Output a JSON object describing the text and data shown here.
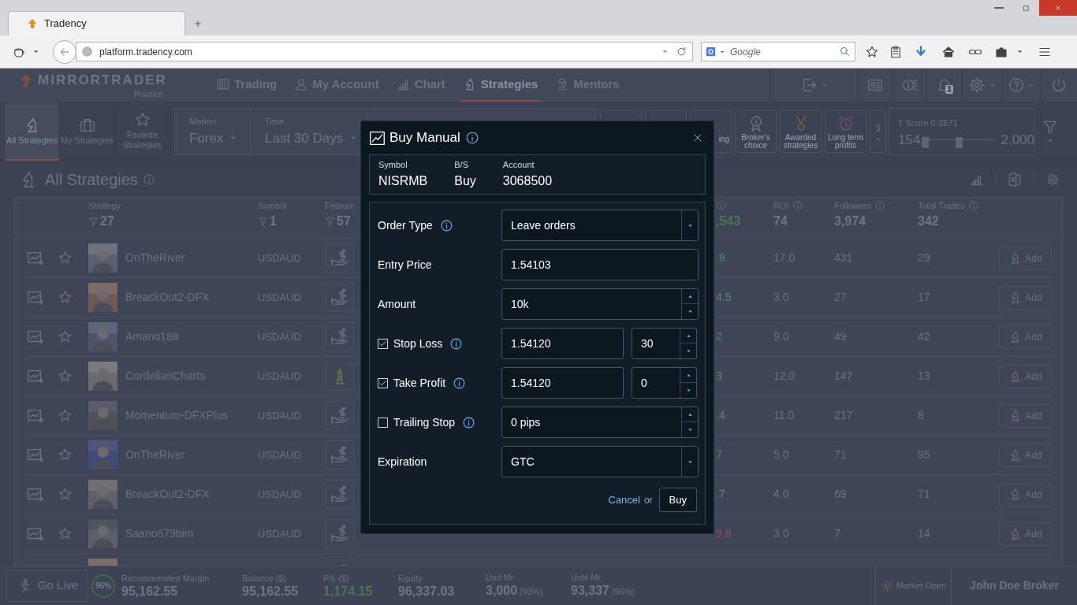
{
  "browser": {
    "tab_title": "Tradency",
    "url": "platform.tradency.com",
    "search_placeholder": "Google"
  },
  "app": {
    "logo": "MIRRORTRADER",
    "logo_sub": "Practice",
    "nav": [
      {
        "label": "Trading",
        "selected": false
      },
      {
        "label": "My Account",
        "selected": false
      },
      {
        "label": "Chart",
        "selected": false
      },
      {
        "label": "Strategies",
        "selected": true
      },
      {
        "label": "Mentors",
        "selected": false
      }
    ],
    "notification_count": "3",
    "views": [
      {
        "label": "All Strategies",
        "selected": true
      },
      {
        "label": "My Strategies",
        "selected": false
      },
      {
        "label": "Favorite Strategies",
        "selected": false
      }
    ],
    "filters": [
      {
        "label": "Market",
        "value": "Forex"
      },
      {
        "label": "Time",
        "value": "Last 30 Days"
      }
    ],
    "badges": [
      {
        "label": "ing",
        "kind": "partial"
      },
      {
        "label": "Broker's choice",
        "kind": "medal"
      },
      {
        "label": "Awarded strategies",
        "kind": "award"
      },
      {
        "label": "Long term profits",
        "kind": "clock"
      }
    ],
    "more_badges": "3",
    "tscore": {
      "label": "T Score 0-3571",
      "min": "154",
      "max": "2,000"
    },
    "page_title": "All Strategies",
    "table": {
      "columns": [
        {
          "label": "Strategy",
          "count": "27",
          "kind": "filter"
        },
        {
          "label": "Symbol",
          "count": "1",
          "kind": "filter"
        },
        {
          "label": "Feature",
          "count": "57",
          "kind": "filter"
        },
        {
          "count": ",543",
          "kind": "info",
          "positive": true
        },
        {
          "label": "ROI",
          "count": "74",
          "kind": "info"
        },
        {
          "label": "Followers",
          "count": "3,974",
          "kind": "info"
        },
        {
          "label": "Total Trades",
          "count": "342",
          "kind": "info"
        }
      ],
      "rows": [
        {
          "name": "OnTheRiver",
          "symbol": "USDAUD",
          "features": [
            {
              "kind": "hand"
            }
          ],
          "column_4": ".8",
          "negative": false,
          "roi": "17.0",
          "followers": "431",
          "trades": "29",
          "action": "Add"
        },
        {
          "name": "BreackOut2-DFX",
          "symbol": "USDAUD",
          "features": [
            {
              "kind": "hand"
            }
          ],
          "column_4": "4.5",
          "negative": false,
          "roi": "3.0",
          "followers": "27",
          "trades": "17",
          "action": "Add"
        },
        {
          "name": "Amano188",
          "symbol": "USDAUD",
          "features": [
            {
              "kind": "hand"
            }
          ],
          "column_4": "2",
          "negative": false,
          "roi": "9.0",
          "followers": "49",
          "trades": "42",
          "action": "Add"
        },
        {
          "name": "CordelianCharts",
          "symbol": "USDAUD",
          "features": [
            {
              "kind": "lighthouse"
            }
          ],
          "column_4": "3",
          "negative": false,
          "roi": "12.0",
          "followers": "147",
          "trades": "13",
          "action": "Add"
        },
        {
          "name": "Momentum-DFXPlus",
          "symbol": "USDAUD",
          "features": [
            {
              "kind": "hand"
            }
          ],
          "column_4": ".4",
          "negative": false,
          "roi": "11.0",
          "followers": "217",
          "trades": "8",
          "action": "Add"
        },
        {
          "name": "OnTheRiver",
          "symbol": "USDAUD",
          "features": [
            {
              "kind": "hand"
            }
          ],
          "column_4": "7",
          "negative": false,
          "roi": "5.0",
          "followers": "71",
          "trades": "95",
          "action": "Add"
        },
        {
          "name": "BreackOut2-DFX",
          "symbol": "USDAUD",
          "features": [
            {
              "kind": "hand"
            }
          ],
          "column_4": ".7",
          "negative": false,
          "roi": "4.0",
          "followers": "69",
          "trades": "71",
          "action": "Add"
        },
        {
          "name": "Saano679bim",
          "symbol": "USDAUD",
          "features": [
            {
              "kind": "hand"
            }
          ],
          "column_4": "9.8",
          "negative": true,
          "roi": "3.0",
          "followers": "7",
          "trades": "14",
          "action": "Add"
        },
        {
          "features": [
            {
              "kind": "hand"
            }
          ]
        }
      ]
    },
    "footer": {
      "go_live": "Go Live",
      "ratio": "96%",
      "stats": [
        {
          "label": "Recommended Margin",
          "value": "95,162.55"
        },
        {
          "label": "Balance ($)",
          "value": "95,162.55"
        },
        {
          "label": "P/L ($)",
          "value": "1,174.15",
          "positive": true
        },
        {
          "label": "Equity",
          "value": "96,337.03"
        },
        {
          "label": "Usd Mr",
          "value": "3,000",
          "note": "(93%)"
        },
        {
          "label": "Usbl Mr",
          "value": "93,337",
          "note": "(96%)"
        }
      ],
      "market_status": "Market Open",
      "broker": "John Doe Broker"
    }
  },
  "modal": {
    "title": "Buy Manual",
    "summary": [
      {
        "label": "Symbol",
        "value": "NISRMB"
      },
      {
        "label": "B/S",
        "value": "Buy"
      },
      {
        "label": "Account",
        "value": "3068500"
      }
    ],
    "fields": [
      {
        "kind": "select",
        "label": "Order Type",
        "info": true,
        "value": "Leave orders"
      },
      {
        "kind": "input",
        "label": "Entry Price",
        "value": "1.54103"
      },
      {
        "kind": "spinner",
        "label": "Amount",
        "value": "10k"
      },
      {
        "kind": "pair",
        "label": "Stop Loss",
        "checked": true,
        "info": true,
        "value": "1.54120",
        "value_2": "30"
      },
      {
        "kind": "pair",
        "label": "Take Profit",
        "checked": true,
        "info": true,
        "value": "1.54120",
        "value_2": "0"
      },
      {
        "kind": "check_spinner",
        "label": "Trailing Stop",
        "checked": false,
        "info": true,
        "value": "0 pips"
      },
      {
        "kind": "select",
        "label": "Expiration",
        "value": "GTC"
      }
    ],
    "cancel": "Cancel",
    "or": "or",
    "submit": "Buy"
  }
}
